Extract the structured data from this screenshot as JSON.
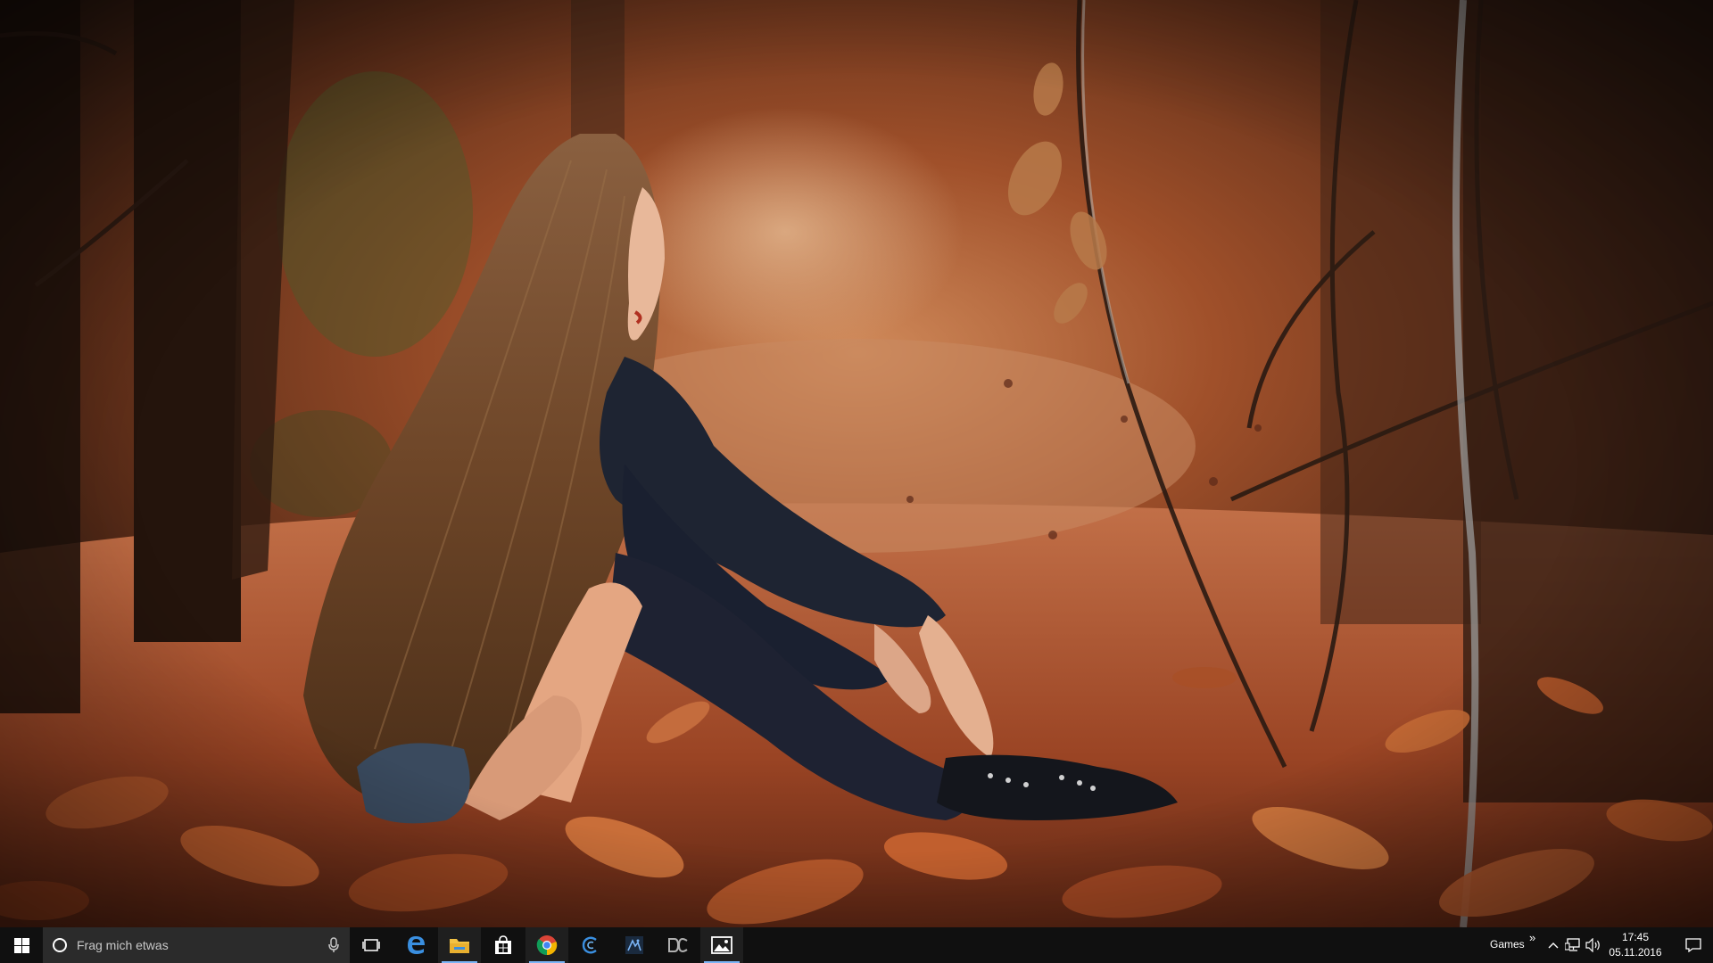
{
  "desktop": {
    "wallpaper": "autumn-forest-girl-wallpaper",
    "palette": {
      "deep": "#2a1810",
      "mid": "#7a3e1e",
      "warm": "#b4582c",
      "leaf": "#c86430",
      "hair": "#7a5230",
      "dress": "#1e2432"
    }
  },
  "taskbar": {
    "background": "#101010",
    "start_icon": "windows-logo-icon",
    "search": {
      "placeholder": "Frag mich etwas",
      "icon": "cortana-circle-icon",
      "mic_icon": "microphone-icon"
    },
    "apps": [
      {
        "name": "task-view",
        "icon": "task-view-icon",
        "active": false
      },
      {
        "name": "edge",
        "icon": "edge-icon",
        "active": false
      },
      {
        "name": "file-explorer",
        "icon": "folder-icon",
        "active": true
      },
      {
        "name": "store",
        "icon": "store-icon",
        "active": false
      },
      {
        "name": "chrome",
        "icon": "chrome-icon",
        "active": true
      },
      {
        "name": "app-c",
        "icon": "c-app-icon",
        "active": false
      },
      {
        "name": "app-dark",
        "icon": "dark-app-icon",
        "active": false
      },
      {
        "name": "app-dc",
        "icon": "dc-app-icon",
        "active": false
      },
      {
        "name": "photos",
        "icon": "photos-icon",
        "active": true
      }
    ],
    "accent": "#7ab4f5",
    "tray": {
      "toolbar_label": "Games",
      "overflow_glyph": "»",
      "clock_time": "17:45",
      "clock_date": "05.11.2016"
    }
  }
}
